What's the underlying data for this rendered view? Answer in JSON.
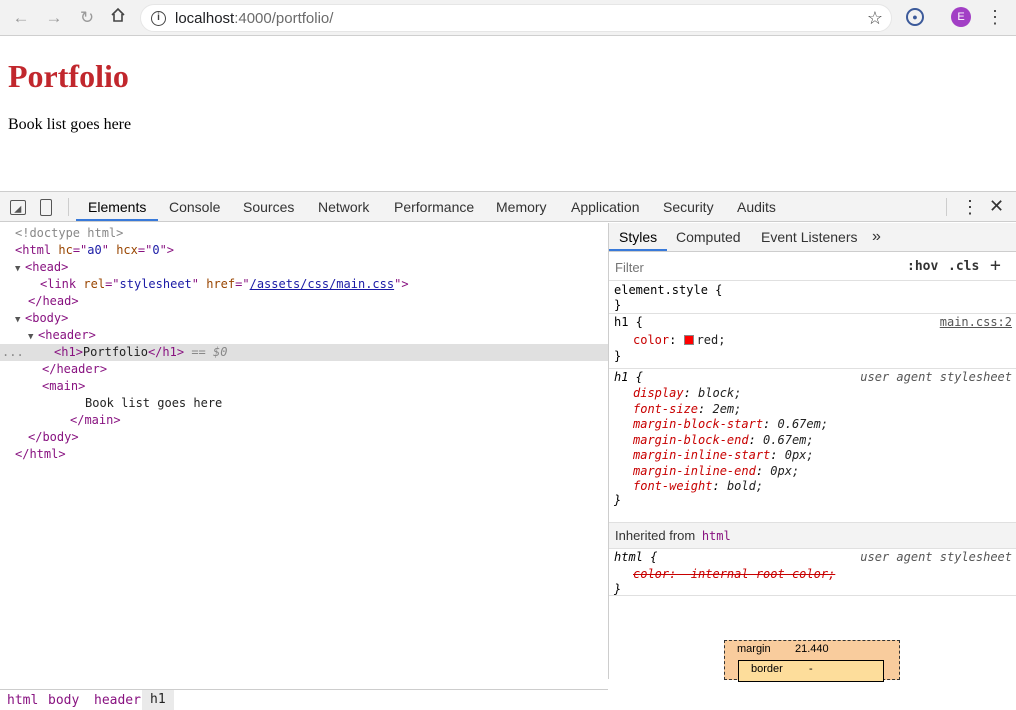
{
  "browser": {
    "url_host": "localhost",
    "url_rest": ":4000/portfolio/",
    "avatar_letter": "E"
  },
  "page": {
    "heading": "Portfolio",
    "paragraph": "Book list goes here"
  },
  "devtools": {
    "tabs": [
      "Elements",
      "Console",
      "Sources",
      "Network",
      "Performance",
      "Memory",
      "Application",
      "Security",
      "Audits"
    ],
    "active_tab": "Elements",
    "dom": {
      "doctype": "<!doctype html>",
      "html_open": "html",
      "html_attr1_name": "hc",
      "html_attr1_val": "a0",
      "html_attr2_name": "hcx",
      "html_attr2_val": "0",
      "head": "head",
      "link": "link",
      "link_rel_name": "rel",
      "link_rel_val": "stylesheet",
      "link_href_name": "href",
      "link_href_val": "/assets/css/main.css",
      "body": "body",
      "header": "header",
      "h1_tag": "h1",
      "h1_text": "Portfolio",
      "selected_suffix": "== $0",
      "main": "main",
      "main_text": "Book list goes here",
      "ellipsis": "..."
    },
    "breadcrumbs": [
      "html",
      "body",
      "header",
      "h1"
    ],
    "styles": {
      "tabs": [
        "Styles",
        "Computed",
        "Event Listeners",
        "»"
      ],
      "filter_placeholder": "Filter",
      "hov": ":hov",
      "cls": ".cls",
      "plus": "+",
      "element_style": "element.style {",
      "close_brace": "}",
      "rule1_selector": "h1 {",
      "rule1_source": "main.css:2",
      "rule1_prop": "color",
      "rule1_val": "red;",
      "rule2_selector": "h1 {",
      "rule2_source": "user agent stylesheet",
      "rule2_props": [
        {
          "name": "display",
          "value": "block;"
        },
        {
          "name": "font-size",
          "value": "2em;"
        },
        {
          "name": "margin-block-start",
          "value": "0.67em;"
        },
        {
          "name": "margin-block-end",
          "value": "0.67em;"
        },
        {
          "name": "margin-inline-start",
          "value": "0px;"
        },
        {
          "name": "margin-inline-end",
          "value": "0px;"
        },
        {
          "name": "font-weight",
          "value": "bold;"
        }
      ],
      "inherited_label": "Inherited from",
      "inherited_tag": "html",
      "rule3_selector": "html {",
      "rule3_source": "user agent stylesheet",
      "rule3_prop": "color: -internal-root-color;",
      "boxmodel_margin_label": "margin",
      "boxmodel_margin_value": "21.440",
      "boxmodel_border_label": "border",
      "boxmodel_border_value": "-"
    }
  },
  "colors": {
    "heading": "#c1272d",
    "active_tab_underline": "#3879d9",
    "tag": "#881280",
    "avatar": "#a23fc5"
  }
}
